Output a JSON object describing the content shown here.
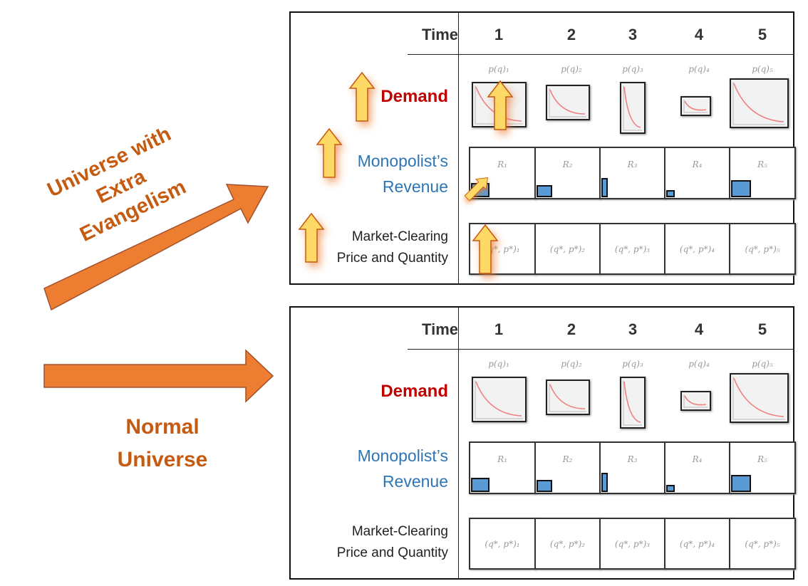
{
  "colors": {
    "arrow": "#ed7d31",
    "label_orange": "#c55a11",
    "demand": "#c00000",
    "revenue": "#2e75b6",
    "bar": "#5b9bd5",
    "curve": "#f08080",
    "glow_arrow": "#ffd966"
  },
  "left": {
    "top_label": [
      "Universe with",
      "Extra",
      "Evangelism"
    ],
    "bottom_label": [
      "Normal",
      "Universe"
    ]
  },
  "panels": [
    {
      "name": "extra-evangelism",
      "time_label": "Time",
      "periods": [
        "1",
        "2",
        "3",
        "4",
        "5"
      ],
      "rows": {
        "demand": "Demand",
        "revenue": [
          "Monopolist’s",
          "Revenue"
        ],
        "market": [
          "Market-Clearing",
          "Price and Quantity"
        ]
      },
      "demand_labels": [
        "p(q)₁",
        "p(q)₂",
        "p(q)₃",
        "p(q)₄",
        "p(q)₅"
      ],
      "revenue_labels": [
        "R₁",
        "R₂",
        "R₃",
        "R₄",
        "R₅"
      ],
      "market_labels": [
        "(q*, p*)₁",
        "(q*, p*)₂",
        "(q*, p*)₃",
        "(q*, p*)₄",
        "(q*, p*)₅"
      ]
    },
    {
      "name": "normal",
      "time_label": "Time",
      "periods": [
        "1",
        "2",
        "3",
        "4",
        "5"
      ],
      "rows": {
        "demand": "Demand",
        "revenue": [
          "Monopolist’s",
          "Revenue"
        ],
        "market": [
          "Market-Clearing",
          "Price and Quantity"
        ]
      },
      "demand_labels": [
        "p(q)₁",
        "p(q)₂",
        "p(q)₃",
        "p(q)₄",
        "p(q)₅"
      ],
      "revenue_labels": [
        "R₁",
        "R₂",
        "R₃",
        "R₄",
        "R₅"
      ],
      "market_labels": [
        "(q*, p*)₁",
        "(q*, p*)₂",
        "(q*, p*)₃",
        "(q*, p*)₄",
        "(q*, p*)₅"
      ]
    }
  ]
}
